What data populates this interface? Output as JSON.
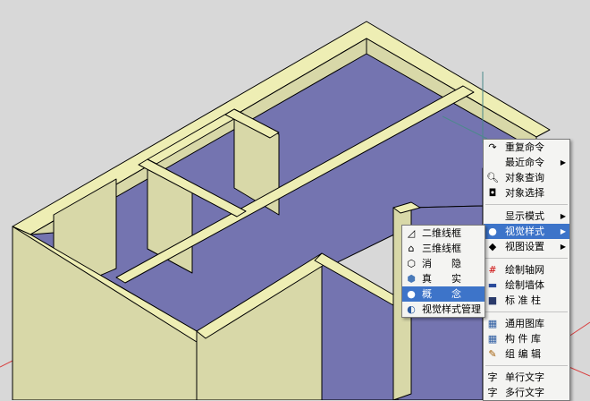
{
  "colors": {
    "background": "#d8d8d8",
    "wall_top": "#eeeeb4",
    "wall_side": "#d8d8a8",
    "floor": "#7474b0",
    "menu_bg": "#f4f4f2",
    "menu_highlight": "#3d74c9"
  },
  "context_menu": {
    "items": [
      {
        "label": "重复命令",
        "icon": "repeat-arrow-icon",
        "submenu": false
      },
      {
        "label": "最近命令",
        "icon": "",
        "submenu": true
      },
      {
        "label": "对象查询",
        "icon": "object-query-icon",
        "submenu": false
      },
      {
        "label": "对象选择",
        "icon": "object-select-icon",
        "submenu": false
      },
      {
        "label": "显示模式",
        "icon": "",
        "submenu": true
      },
      {
        "label": "视觉样式",
        "icon": "visual-style-sphere-icon",
        "submenu": true,
        "highlighted": true
      },
      {
        "label": "视图设置",
        "icon": "view-settings-icon",
        "submenu": true
      },
      {
        "label": "绘制轴网",
        "icon": "axis-grid-icon",
        "submenu": false
      },
      {
        "label": "绘制墙体",
        "icon": "wall-icon",
        "submenu": false
      },
      {
        "label": "标 准 柱",
        "icon": "column-icon",
        "submenu": false
      },
      {
        "label": "通用图库",
        "icon": "library-icon",
        "submenu": false
      },
      {
        "label": "构 件 库",
        "icon": "component-library-icon",
        "submenu": false
      },
      {
        "label": "组 编 辑",
        "icon": "group-edit-icon",
        "submenu": false
      },
      {
        "label": "单行文字",
        "icon": "single-line-text-icon",
        "submenu": false
      },
      {
        "label": "多行文字",
        "icon": "multi-line-text-icon",
        "submenu": false
      }
    ]
  },
  "visual_style_submenu": {
    "items": [
      {
        "label": "二维线框",
        "icon": "2d-wireframe-icon"
      },
      {
        "label": "三维线框",
        "icon": "3d-wireframe-icon"
      },
      {
        "label": "消　　隐",
        "icon": "hidden-icon"
      },
      {
        "label": "真　　实",
        "icon": "realistic-icon"
      },
      {
        "label": "概　　念",
        "icon": "conceptual-icon",
        "highlighted": true
      },
      {
        "label": "视觉样式管理",
        "icon": "visual-style-manager-icon"
      }
    ]
  }
}
